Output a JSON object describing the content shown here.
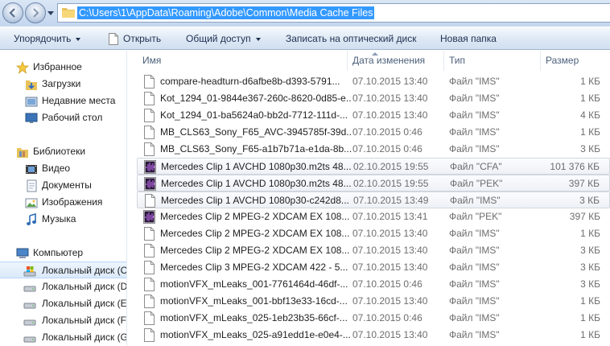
{
  "address": {
    "path": "C:\\Users\\1\\AppData\\Roaming\\Adobe\\Common\\Media Cache Files"
  },
  "toolbar": {
    "organize": "Упорядочить",
    "open": "Открыть",
    "share": "Общий доступ",
    "burn": "Записать на оптический диск",
    "new_folder": "Новая папка"
  },
  "nav": {
    "favorites": "Избранное",
    "downloads": "Загрузки",
    "recent": "Недавние места",
    "desktop": "Рабочий стол",
    "libraries": "Библиотеки",
    "video": "Видео",
    "documents": "Документы",
    "images": "Изображения",
    "music": "Музыка",
    "computer": "Компьютер",
    "disks": [
      "Локальный диск (C",
      "Локальный диск (D",
      "Локальный диск (E:",
      "Локальный диск (F:",
      "Локальный диск (G"
    ]
  },
  "columns": {
    "name": "Имя",
    "date": "Дата изменения",
    "type": "Тип",
    "size": "Размер"
  },
  "files": [
    {
      "name": "compare-headturn-d6afbe8b-d393-5791...",
      "date": "07.10.2015 13:40",
      "type": "Файл \"IMS\"",
      "size": "1 КБ",
      "icon": "blank-file-icon"
    },
    {
      "name": "Kot_1294_01-9844e367-260c-8620-0d85-e...",
      "date": "07.10.2015 13:40",
      "type": "Файл \"IMS\"",
      "size": "1 КБ",
      "icon": "blank-file-icon"
    },
    {
      "name": "Kot_1294_01-ba5624a0-bb2d-7712-111d-...",
      "date": "07.10.2015 13:40",
      "type": "Файл \"IMS\"",
      "size": "4 КБ",
      "icon": "blank-file-icon"
    },
    {
      "name": "MB_CLS63_Sony_F65_AVC-3945785f-39d...",
      "date": "07.10.2015 0:46",
      "type": "Файл \"IMS\"",
      "size": "1 КБ",
      "icon": "blank-file-icon"
    },
    {
      "name": "MB_CLS63_Sony_F65-a1b7b71a-e1da-8b...",
      "date": "07.10.2015 0:46",
      "type": "Файл \"IMS\"",
      "size": "3 КБ",
      "icon": "blank-file-icon"
    },
    {
      "name": "Mercedes Clip 1 AVCHD 1080p30.m2ts 48...",
      "date": "02.10.2015 19:55",
      "type": "Файл \"CFA\"",
      "size": "101 376 КБ",
      "icon": "audio-file-icon",
      "selected": true
    },
    {
      "name": "Mercedes Clip 1 AVCHD 1080p30.m2ts 48...",
      "date": "02.10.2015 19:55",
      "type": "Файл \"PEK\"",
      "size": "397 КБ",
      "icon": "audio-file-icon",
      "selected": true
    },
    {
      "name": "Mercedes Clip 1 AVCHD 1080p30-c242d8...",
      "date": "07.10.2015 13:49",
      "type": "Файл \"IMS\"",
      "size": "3 КБ",
      "icon": "blank-file-icon",
      "selected": true
    },
    {
      "name": "Mercedes Clip 2 MPEG-2 XDCAM EX 108...",
      "date": "07.10.2015 13:41",
      "type": "Файл \"PEK\"",
      "size": "397 КБ",
      "icon": "audio-file-icon"
    },
    {
      "name": "Mercedes Clip 2 MPEG-2 XDCAM EX 108...",
      "date": "07.10.2015 13:40",
      "type": "Файл \"IMS\"",
      "size": "1 КБ",
      "icon": "blank-file-icon"
    },
    {
      "name": "Mercedes Clip 2 MPEG-2 XDCAM EX 108...",
      "date": "07.10.2015 13:40",
      "type": "Файл \"IMS\"",
      "size": "3 КБ",
      "icon": "blank-file-icon"
    },
    {
      "name": "Mercedes Clip 3 MPEG-2 XDCAM 422 - 5...",
      "date": "07.10.2015 13:40",
      "type": "Файл \"IMS\"",
      "size": "3 КБ",
      "icon": "blank-file-icon"
    },
    {
      "name": "motionVFX_mLeaks_001-7761464d-46df-...",
      "date": "07.10.2015 0:46",
      "type": "Файл \"IMS\"",
      "size": "3 КБ",
      "icon": "blank-file-icon"
    },
    {
      "name": "motionVFX_mLeaks_001-bbf13e33-16cd-...",
      "date": "07.10.2015 13:40",
      "type": "Файл \"IMS\"",
      "size": "1 КБ",
      "icon": "blank-file-icon"
    },
    {
      "name": "motionVFX_mLeaks_025-1eb23b35-66cf-...",
      "date": "07.10.2015 0:46",
      "type": "Файл \"IMS\"",
      "size": "1 КБ",
      "icon": "blank-file-icon"
    },
    {
      "name": "motionVFX_mLeaks_025-a91edd1e-e0e4-...",
      "date": "07.10.2015 13:40",
      "type": "Файл \"IMS\"",
      "size": "1 КБ",
      "icon": "blank-file-icon"
    }
  ]
}
